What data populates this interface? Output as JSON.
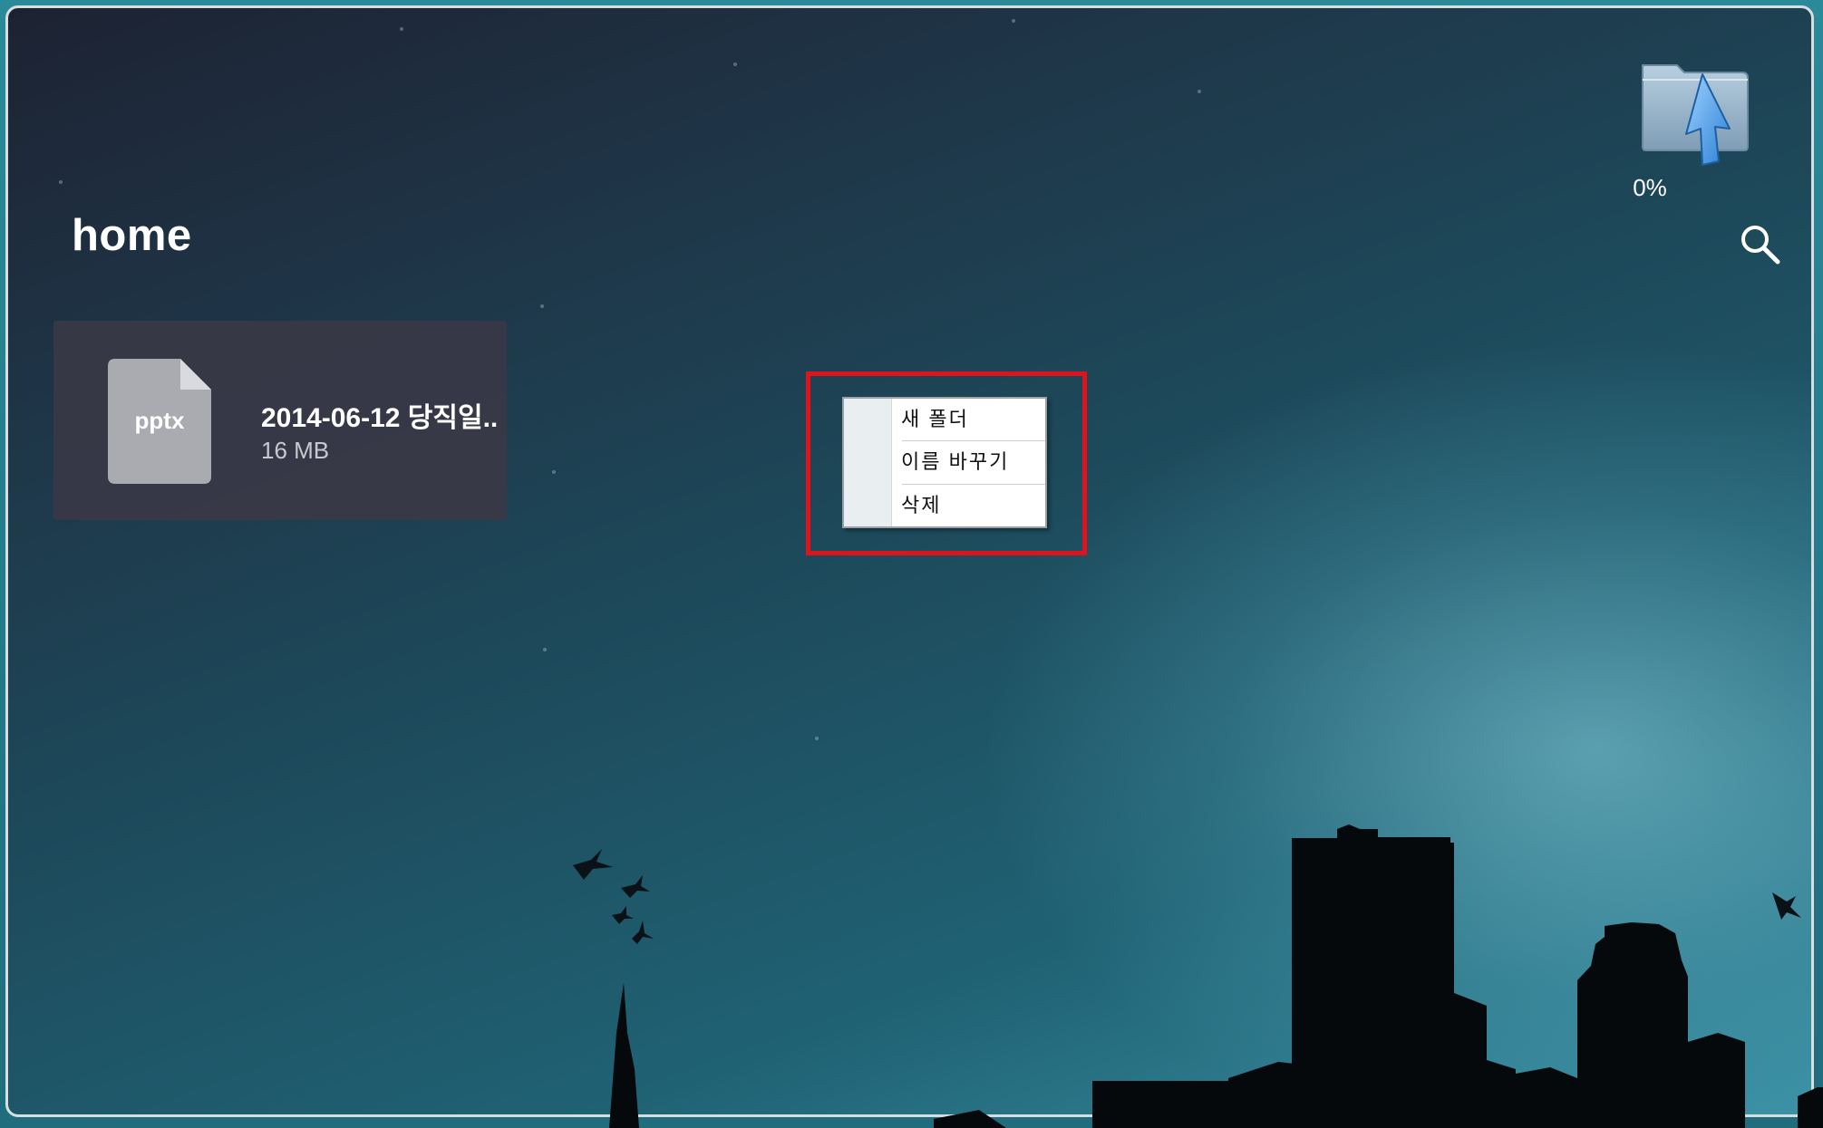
{
  "header": {
    "title": "home"
  },
  "upload": {
    "percent_label": "0%",
    "progress": 0
  },
  "toolbar": {
    "search_icon": "search-icon"
  },
  "files": [
    {
      "name": "2014-06-12 당직일..",
      "size": "16 MB",
      "extension": "pptx",
      "icon": "document-icon"
    }
  ],
  "context_menu": {
    "items": [
      {
        "label": "새 폴더"
      },
      {
        "label": "이름 바꾸기"
      },
      {
        "label": "삭제"
      }
    ]
  },
  "colors": {
    "highlight": "#e0121c",
    "card_background": "#3a3846",
    "menu_gutter": "#e9eef0"
  }
}
